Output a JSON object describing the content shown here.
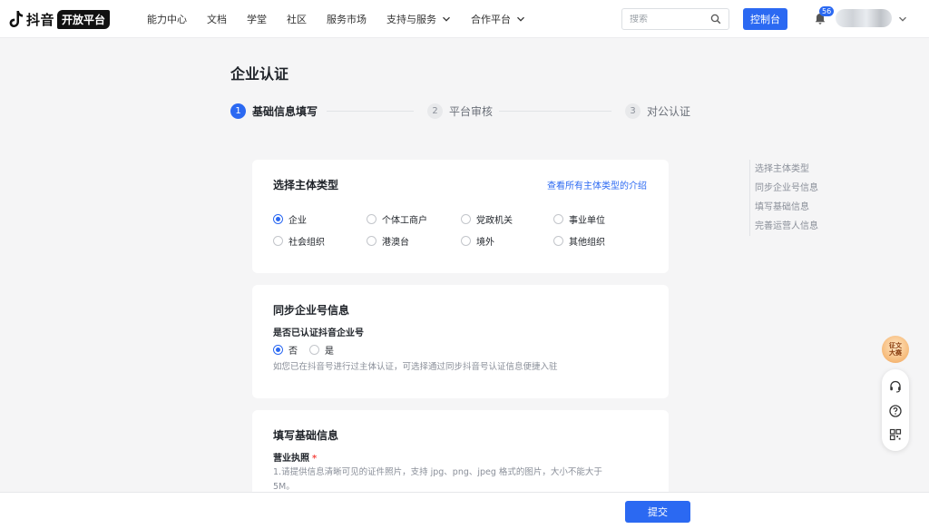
{
  "brand": {
    "name": "抖音",
    "badge": "开放平台"
  },
  "nav": {
    "items": [
      {
        "label": "能力中心",
        "has_dropdown": false
      },
      {
        "label": "文档",
        "has_dropdown": false
      },
      {
        "label": "学堂",
        "has_dropdown": false
      },
      {
        "label": "社区",
        "has_dropdown": false
      },
      {
        "label": "服务市场",
        "has_dropdown": false
      },
      {
        "label": "支持与服务",
        "has_dropdown": true
      },
      {
        "label": "合作平台",
        "has_dropdown": true
      }
    ],
    "search_placeholder": "搜索",
    "console_label": "控制台",
    "notification_count": "56"
  },
  "page": {
    "title": "企业认证",
    "steps": [
      {
        "num": "1",
        "label": "基础信息填写",
        "active": true
      },
      {
        "num": "2",
        "label": "平台审核",
        "active": false
      },
      {
        "num": "3",
        "label": "对公认证",
        "active": false
      }
    ]
  },
  "section_subject": {
    "title": "选择主体类型",
    "link": "查看所有主体类型的介绍",
    "options": [
      {
        "label": "企业",
        "checked": true
      },
      {
        "label": "个体工商户",
        "checked": false
      },
      {
        "label": "党政机关",
        "checked": false
      },
      {
        "label": "事业单位",
        "checked": false
      },
      {
        "label": "社会组织",
        "checked": false
      },
      {
        "label": "港澳台",
        "checked": false
      },
      {
        "label": "境外",
        "checked": false
      },
      {
        "label": "其他组织",
        "checked": false
      }
    ]
  },
  "section_sync": {
    "title": "同步企业号信息",
    "question": "是否已认证抖音企业号",
    "options": [
      {
        "label": "否",
        "checked": true
      },
      {
        "label": "是",
        "checked": false
      }
    ],
    "hint": "如您已在抖音号进行过主体认证，可选择通过同步抖音号认证信息便捷入驻"
  },
  "section_basic": {
    "title": "填写基础信息",
    "license_label": "营业执照",
    "required_mark": "*",
    "hint_line1": "1.请提供信息清晰可见的证件照片，支持 jpg、png、jpeg 格式的图片，大小不能大于",
    "hint_line2": "5M。"
  },
  "anchors": [
    "选择主体类型",
    "同步企业号信息",
    "填写基础信息",
    "完善运营人信息"
  ],
  "float": {
    "promo_line1": "征文",
    "promo_line2": "大赛",
    "icons": [
      "headset-icon",
      "help-icon",
      "qrcode-icon"
    ]
  },
  "footer": {
    "submit_label": "提交"
  },
  "colors": {
    "accent": "#2b69f2",
    "page_bg": "#f5f5f6",
    "card_bg": "#ffffff",
    "required": "#f54a45"
  }
}
